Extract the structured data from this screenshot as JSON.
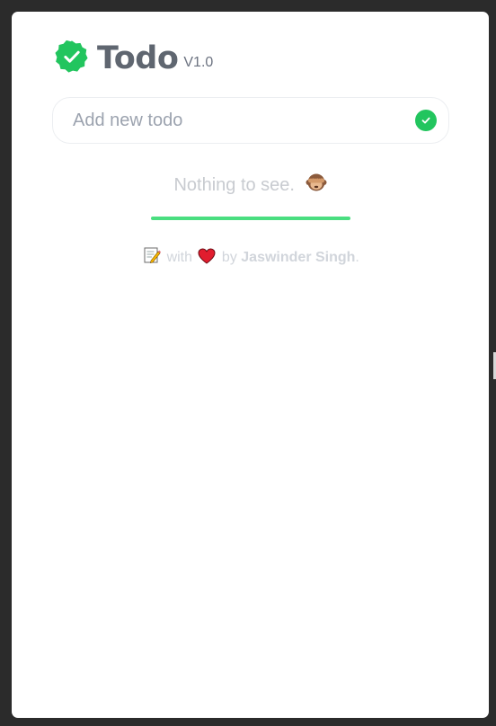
{
  "app": {
    "title": "Todo",
    "version": "V1.0"
  },
  "input": {
    "placeholder": "Add new todo",
    "value": ""
  },
  "empty_state": {
    "text": "Nothing to see.",
    "emoji_icon": "see-no-evil-monkey-icon"
  },
  "progress": {
    "fraction": 1.0,
    "color": "#4ade80"
  },
  "footer": {
    "lead_icon": "memo-icon",
    "with_text": "with",
    "heart_icon": "heart-icon",
    "by_text": "by",
    "author": "Jaswinder Singh",
    "trailing": "."
  },
  "colors": {
    "accent": "#22c55e",
    "title": "#5f6670",
    "muted": "#c8cbd0"
  }
}
